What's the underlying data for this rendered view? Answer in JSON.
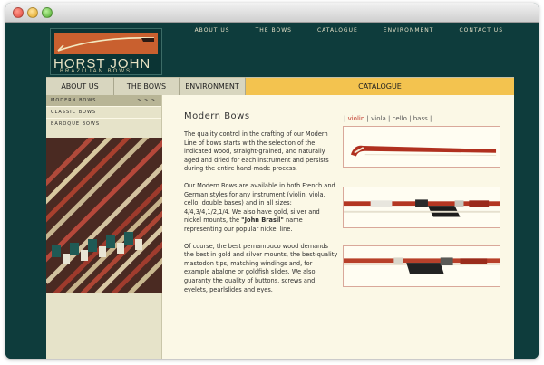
{
  "logo": {
    "name": "HORST JOHN",
    "tagline": "BRAZILIAN BOWS"
  },
  "topnav": [
    "ABOUT US",
    "THE BOWS",
    "CATALOGUE",
    "ENVIRONMENT",
    "CONTACT US"
  ],
  "mainnav": [
    "ABOUT US",
    "THE BOWS",
    "ENVIRONMENT",
    "CATALOGUE"
  ],
  "sidebar": {
    "items": [
      "MODERN BOWS",
      "CLASSIC BOWS",
      "BAROQUE BOWS"
    ],
    "arrows": "> > >"
  },
  "content": {
    "heading": "Modern Bows",
    "p1": "The quality control in the crafting of our Modern Line of bows starts with the selection of the indicated wood, straight-grained, and naturally aged and dried for each instrument and persists during the entire hand-made process.",
    "p2a": "Our Modern Bows are available in both French and German styles for any instrument (violin, viola, cello, double bases) and in all sizes: 4/4,3/4,1/2,1/4. We also have gold, silver and nickel mounts, the ",
    "p2b": "\"John Brasil\"",
    "p2c": " name representing our popular nickel line.",
    "p3": "Of course, the best pernambuco wood demands the best in gold and silver mounts, the best-quality mastodon tips, matching windings and, for example abalone or goldfish slides. We also guaranty the quality of buttons, screws and eyelets, pearlslides and eyes."
  },
  "catalogue_links": {
    "open": "|",
    "sep": "|",
    "close": "|",
    "items": [
      "violin",
      "viola",
      "cello",
      "bass"
    ]
  },
  "colors": {
    "background": "#0e3c3c",
    "accent": "#f3c34f",
    "link_active": "#c0392b",
    "content_bg": "#fbf8e6"
  }
}
